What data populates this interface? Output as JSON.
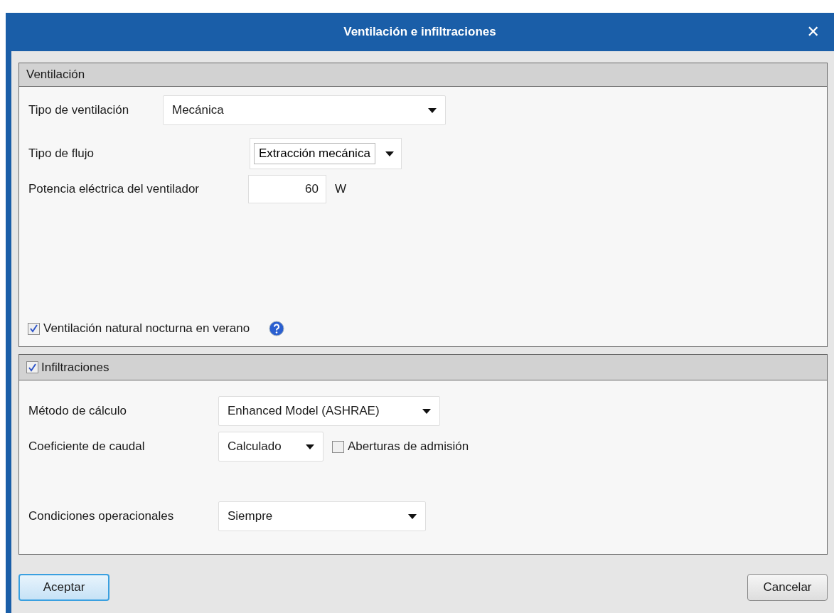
{
  "window": {
    "title": "Ventilación e infiltraciones",
    "close": "✕"
  },
  "ventilation": {
    "title": "Ventilación",
    "fields": [
      {
        "kind": "dropdown",
        "label": "Tipo de ventilación",
        "value": "Mecánica"
      },
      {
        "kind": "dropdown-inset",
        "label": "Tipo de flujo",
        "value": "Extracción mecánica"
      },
      {
        "kind": "number",
        "label": "Potencia eléctrica del ventilador",
        "value": "60",
        "unit": "W"
      }
    ],
    "night_ventilation": {
      "label": "Ventilación natural nocturna en verano",
      "checked": true
    }
  },
  "infiltration": {
    "title": "Infiltraciones",
    "checked": true,
    "fields": [
      {
        "kind": "dropdown",
        "label": "Método de cálculo",
        "value": "Enhanced Model (ASHRAE)"
      },
      {
        "kind": "dropdown",
        "label": "Coeficiente de caudal",
        "value": "Calculado",
        "checkbox": {
          "label": "Aberturas de admisión",
          "checked": false
        }
      },
      {
        "kind": "dropdown",
        "label": "Condiciones operacionales",
        "value": "Siempre"
      }
    ]
  },
  "buttons": [
    {
      "label": "Aceptar",
      "default": true
    },
    {
      "label": "Cancelar",
      "default": false
    }
  ]
}
